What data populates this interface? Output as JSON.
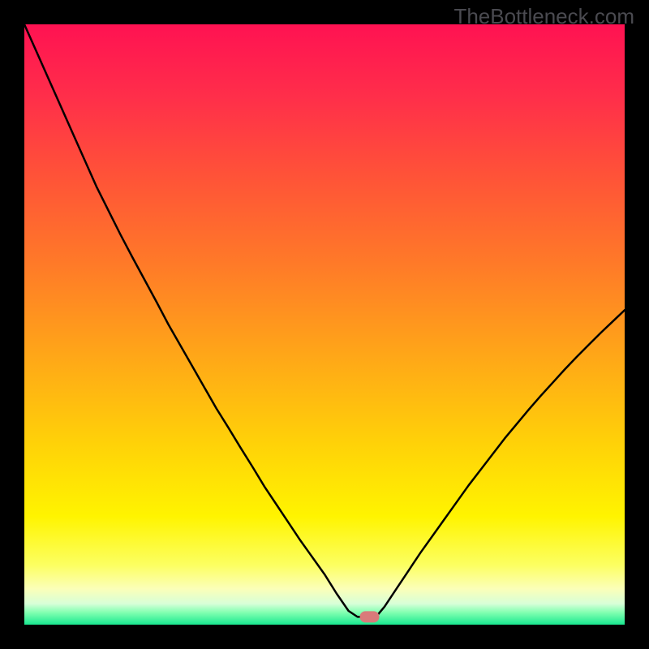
{
  "watermark": "TheBottleneck.com",
  "chart_data": {
    "type": "line",
    "x": [
      0.0,
      0.02,
      0.04,
      0.06,
      0.08,
      0.1,
      0.12,
      0.14,
      0.16,
      0.18,
      0.2,
      0.22,
      0.24,
      0.26,
      0.28,
      0.3,
      0.32,
      0.34,
      0.36,
      0.38,
      0.4,
      0.42,
      0.44,
      0.46,
      0.48,
      0.5,
      0.52,
      0.54,
      0.555,
      0.57,
      0.575,
      0.59,
      0.6,
      0.62,
      0.64,
      0.66,
      0.68,
      0.7,
      0.72,
      0.74,
      0.76,
      0.78,
      0.8,
      0.82,
      0.84,
      0.86,
      0.88,
      0.9,
      0.92,
      0.94,
      0.96,
      0.98,
      1.0
    ],
    "values": [
      1.0,
      0.955,
      0.91,
      0.865,
      0.82,
      0.775,
      0.73,
      0.69,
      0.65,
      0.612,
      0.575,
      0.538,
      0.5,
      0.465,
      0.43,
      0.395,
      0.36,
      0.328,
      0.295,
      0.263,
      0.23,
      0.2,
      0.17,
      0.14,
      0.112,
      0.084,
      0.052,
      0.023,
      0.013,
      0.013,
      0.013,
      0.018,
      0.03,
      0.06,
      0.09,
      0.12,
      0.148,
      0.176,
      0.204,
      0.232,
      0.258,
      0.284,
      0.31,
      0.334,
      0.358,
      0.381,
      0.403,
      0.425,
      0.446,
      0.466,
      0.486,
      0.505,
      0.524
    ],
    "xlim": [
      0,
      1
    ],
    "ylim": [
      0,
      1
    ],
    "title": "",
    "xlabel": "",
    "ylabel": "",
    "marker": {
      "x": 0.575,
      "y": 0.013,
      "color": "#d97a7a"
    },
    "green_band": {
      "y_start": 0.0,
      "y_end": 0.035
    },
    "gradient_stops": [
      {
        "offset": 0.0,
        "color": "#ff1252"
      },
      {
        "offset": 0.12,
        "color": "#ff2e4a"
      },
      {
        "offset": 0.25,
        "color": "#ff5238"
      },
      {
        "offset": 0.4,
        "color": "#ff7a28"
      },
      {
        "offset": 0.55,
        "color": "#ffa618"
      },
      {
        "offset": 0.7,
        "color": "#ffd208"
      },
      {
        "offset": 0.82,
        "color": "#fff400"
      },
      {
        "offset": 0.9,
        "color": "#fcff60"
      },
      {
        "offset": 0.94,
        "color": "#fbffb8"
      },
      {
        "offset": 0.965,
        "color": "#d8ffd8"
      },
      {
        "offset": 0.98,
        "color": "#80ffb0"
      },
      {
        "offset": 1.0,
        "color": "#18e890"
      }
    ]
  }
}
